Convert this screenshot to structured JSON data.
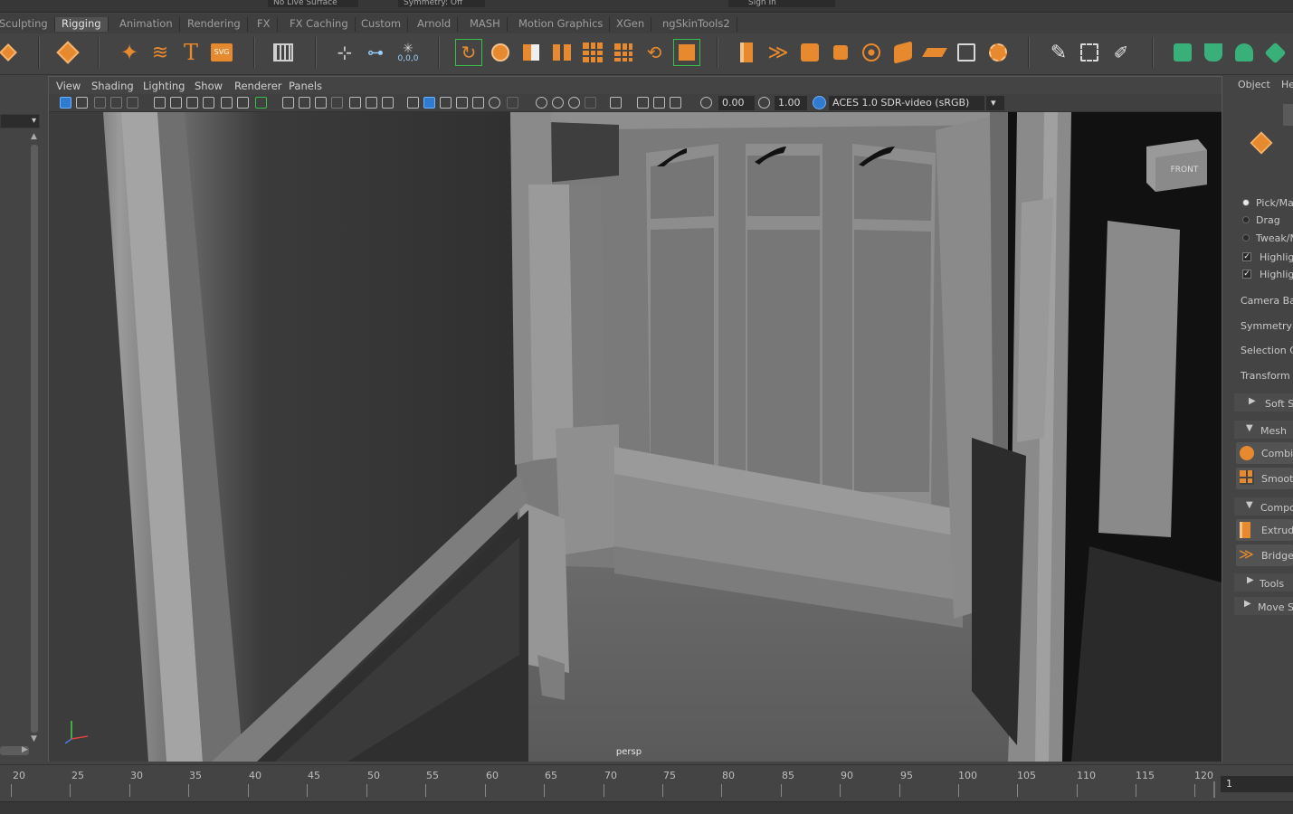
{
  "shelf_tabs": [
    "Sculpting",
    "Rigging",
    "Animation",
    "Rendering",
    "FX",
    "FX Caching",
    "Custom",
    "Arnold",
    "MASH",
    "Motion Graphics",
    "XGen",
    "ngSkinTools2"
  ],
  "shelf_active_tab": "Rigging",
  "top_strip": {
    "live_surface": "No Live Surface",
    "symmetry": "Symmetry: Off",
    "sign_in": "Sign In"
  },
  "shelf_icons": [
    "orbit-icon",
    "poly-sphere-icon",
    "sparkle-icon",
    "sweep-icon",
    "text-icon",
    "svg-icon",
    "grid-icon",
    "locator-icon",
    "snap-icon",
    "freeze-icon",
    "reset-icon",
    "bevel-icon",
    "combine-icon",
    "separate-icon",
    "extract-icon",
    "mirror-icon",
    "smooth-icon",
    "boolean-icon",
    "remesh-icon",
    "extrude-icon",
    "bridge-icon",
    "bevel-cube-icon",
    "append-icon",
    "sphere-grid-icon",
    "cube-flip-icon",
    "planar-icon",
    "uv-icon",
    "uv-tool-icon",
    "multicut-icon",
    "edge-loop-icon",
    "quad-draw-icon",
    "teal-plane-icon",
    "teal-cube-icon"
  ],
  "shelf_values": {
    "freeze_value": "0,0,0"
  },
  "viewport": {
    "menu": [
      "View",
      "Shading",
      "Lighting",
      "Show",
      "Renderer",
      "Panels"
    ],
    "exposure": "0.00",
    "gamma": "1.00",
    "color_space": "ACES 1.0 SDR-video (sRGB)",
    "camera_label": "persp",
    "viewcube_label": "FRONT"
  },
  "modeling_toolkit": {
    "tabs": [
      "Object",
      "He"
    ],
    "pick_marquee": "Pick/Ma",
    "drag": "Drag",
    "tweak": "Tweak/M",
    "highlight1": "Highlig",
    "highlight2": "Highlig",
    "camera_based": "Camera Bas",
    "symmetry": "Symmetry",
    "selection_constraint": "Selection C",
    "transform_constraint": "Transform C",
    "soft_select": "Soft S",
    "mesh_header": "Mesh",
    "combine": "Combi",
    "smooth": "Smoot",
    "components_header": "Compo",
    "extrude": "Extrud",
    "bridge": "Bridge",
    "tools_header": "Tools",
    "move_settings": "Move S"
  },
  "timeline": {
    "ticks": [
      "20",
      "25",
      "30",
      "35",
      "40",
      "45",
      "50",
      "55",
      "60",
      "65",
      "70",
      "75",
      "80",
      "85",
      "90",
      "95",
      "100",
      "105",
      "110",
      "115",
      "120"
    ],
    "current_frame": "1"
  }
}
